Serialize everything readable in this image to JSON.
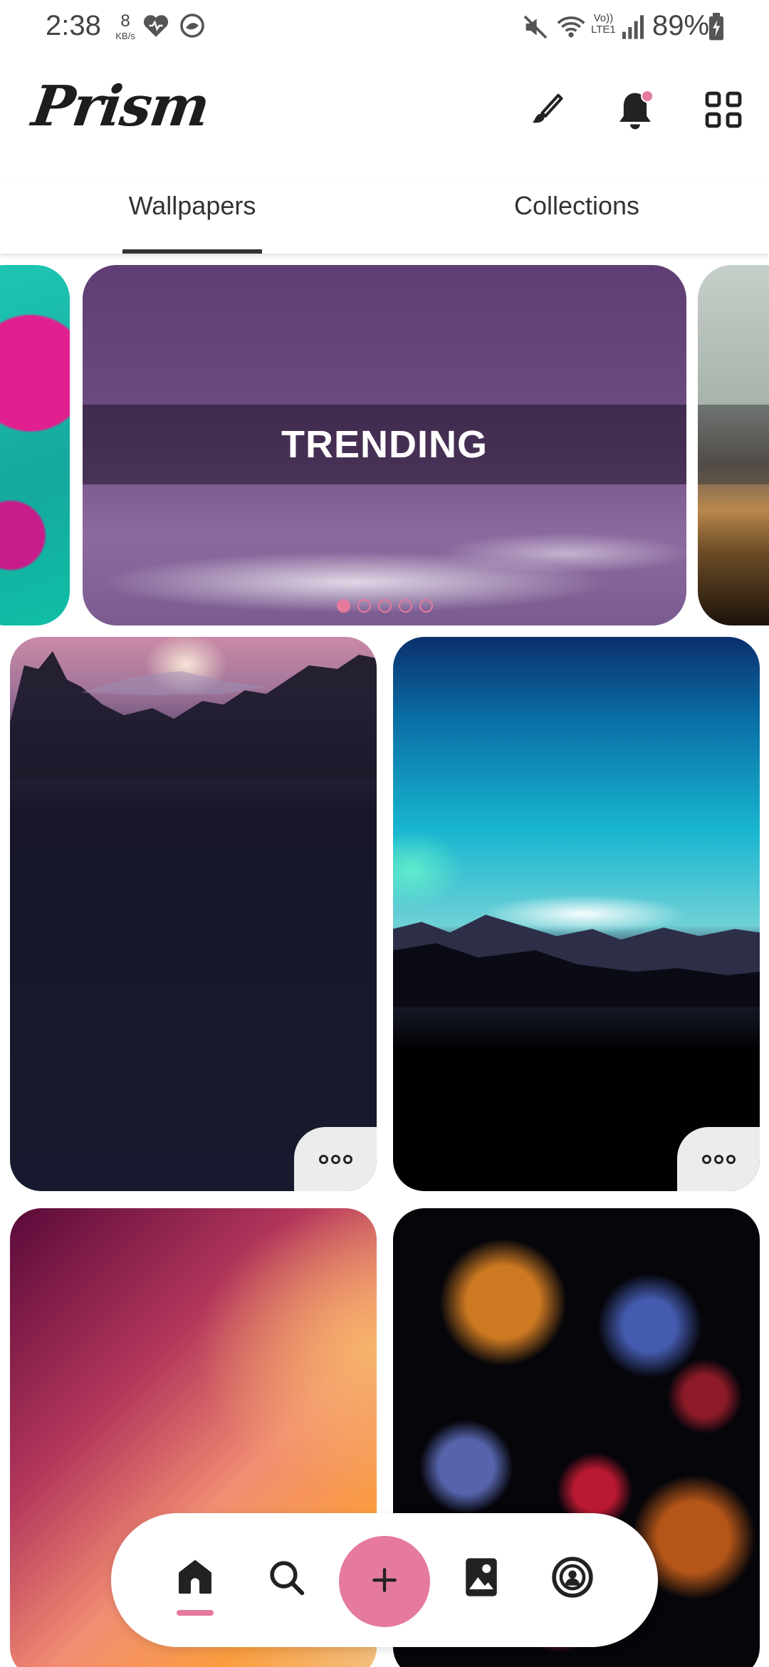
{
  "status_bar": {
    "time": "2:38",
    "net_speed_value": "8",
    "net_speed_unit": "KB/s",
    "battery": "89%",
    "icons": [
      "heart-icon",
      "messenger-icon",
      "mute-icon",
      "wifi-icon",
      "volte-icon",
      "signal-icon",
      "battery-charging-icon"
    ]
  },
  "app_bar": {
    "logo": "Prism",
    "actions": [
      "brush-icon",
      "notification-bell-icon",
      "grid-apps-icon"
    ],
    "notification_dot_color": "#e57a9c"
  },
  "tabs": {
    "items": [
      {
        "label": "Wallpapers",
        "active": true
      },
      {
        "label": "Collections",
        "active": false
      }
    ]
  },
  "carousel": {
    "main_label": "TRENDING",
    "slide_count": 5,
    "active_index": 0
  },
  "grid": {
    "more_button": "more-options-icon"
  },
  "bottom_nav": {
    "items": [
      "home-icon",
      "search-icon",
      "add-icon",
      "image-icon",
      "account-icon"
    ],
    "active": "home-icon",
    "accent_color": "#e57a9c"
  }
}
